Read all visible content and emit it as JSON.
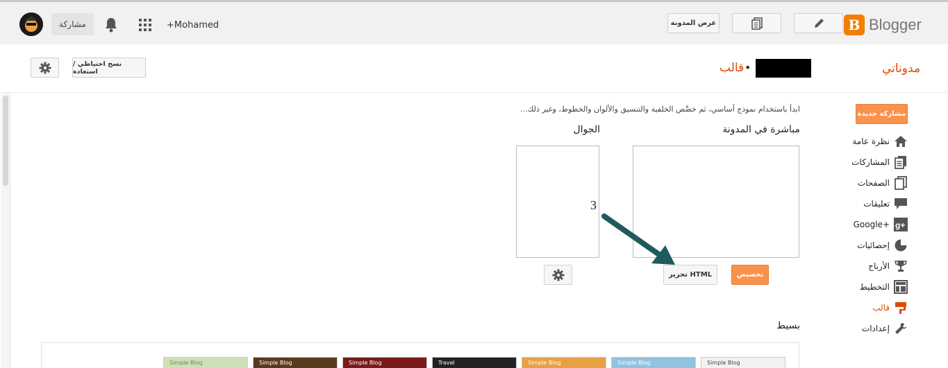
{
  "topbar": {
    "username": "+Mohamed",
    "share_label": "مشاركة",
    "view_blog_label": "عرض المدونة",
    "logo_text": "Blogger",
    "logo_letter": "B"
  },
  "header": {
    "my_blogs": "مدوناتي",
    "separator": "•",
    "page_title": "قالب",
    "backup_label": "نسخ احتياطي / استعادة"
  },
  "sidebar": {
    "new_post_label": "مشاركة جديدة",
    "items": [
      {
        "label": "نظرة عامة",
        "icon": "home-icon"
      },
      {
        "label": "المشاركات",
        "icon": "posts-icon"
      },
      {
        "label": "الصفحات",
        "icon": "pages-icon"
      },
      {
        "label": "تعليقات",
        "icon": "comments-icon"
      },
      {
        "label": "Google+",
        "icon": "google-plus-icon"
      },
      {
        "label": "إحصائيات",
        "icon": "stats-icon"
      },
      {
        "label": "الأرباح",
        "icon": "trophy-icon"
      },
      {
        "label": "التخطيط",
        "icon": "layout-icon"
      },
      {
        "label": "قالب",
        "icon": "template-icon",
        "active": true
      },
      {
        "label": "إعدادات",
        "icon": "wrench-icon"
      }
    ]
  },
  "main": {
    "intro": "ابدأ باستخدام نموذج أساسي، ثم خصِّص الخلفية والتنسيق والألوان والخطوط، وغير ذلك...",
    "live_title": "مباشرة في المدونة",
    "mobile_title": "الجوال",
    "customize_label": "تخصيص",
    "edit_html_label": "تحرير HTML",
    "annotation_number": "3",
    "simple_heading": "بسيط",
    "accent_color": "#f9924b",
    "arrow_color": "#1f5a5e"
  },
  "gallery": {
    "thumbs": [
      {
        "label": "Simple Blog",
        "color": "#cfe0b8"
      },
      {
        "label": "Simple Blog",
        "color": "#5a3a1e"
      },
      {
        "label": "Simple Blog",
        "color": "#7a1a1a"
      },
      {
        "label": "Travel",
        "color": "#222222"
      },
      {
        "label": "Simple Blog",
        "color": "#e8a040"
      },
      {
        "label": "Simple Blog",
        "color": "#8fc3e0"
      },
      {
        "label": "Simple Blog",
        "color": "#f2f2f2"
      }
    ]
  }
}
